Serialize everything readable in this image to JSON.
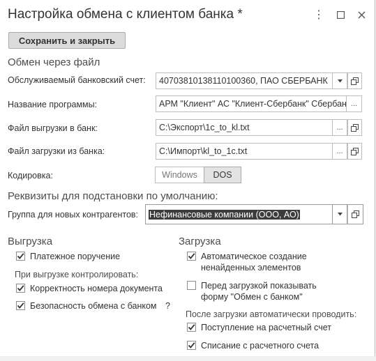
{
  "window": {
    "title": "Настройка обмена с клиентом банка *",
    "more_icon": "⋮",
    "maximize_icon": "☐",
    "close_icon": "✕"
  },
  "toolbar": {
    "save_close_label": "Сохранить и закрыть"
  },
  "file_exchange": {
    "section_title": "Обмен через файл",
    "bank_account_label": "Обслуживаемый банковский счет:",
    "bank_account_value": "40703810138110100360, ПАО СБЕРБАНК",
    "program_label": "Название программы:",
    "program_value": "АРМ \"Клиент\" АС \"Клиент-Сбербанк\" Сбербанк",
    "export_file_label": "Файл выгрузки в банк:",
    "export_file_value": "C:\\Экспорт\\1c_to_kl.txt",
    "import_file_label": "Файл загрузки из банка:",
    "import_file_value": "C:\\Импорт\\kl_to_1c.txt",
    "encoding_label": "Кодировка:",
    "encoding_options": [
      "Windows",
      "DOS"
    ],
    "encoding_selected": "DOS"
  },
  "defaults": {
    "section_title": "Реквизиты для подстановки по умолчанию:",
    "group_label": "Группа для новых контрагентов:",
    "group_value": "Нефинансовые компании (ООО, АО)"
  },
  "export": {
    "section_title": "Выгрузка",
    "payment_order_label": "Платежное поручение",
    "payment_order_checked": true,
    "control_caption": "При выгрузке контролировать:",
    "doc_number_label": "Корректность номера документа",
    "doc_number_checked": true,
    "security_label": "Безопасность обмена с банком",
    "security_checked": true,
    "help_label": "?"
  },
  "import": {
    "section_title": "Загрузка",
    "auto_create_line1": "Автоматическое создание",
    "auto_create_line2": "ненайденных элементов",
    "auto_create_checked": true,
    "show_form_line1": "Перед загрузкой показывать",
    "show_form_line2": "форму \"Обмен с банком\"",
    "show_form_checked": false,
    "auto_post_caption": "После загрузки автоматически проводить:",
    "receipt_label": "Поступление на расчетный счет",
    "receipt_checked": true,
    "writeoff_label": "Списание с расчетного счета",
    "writeoff_checked": true
  }
}
